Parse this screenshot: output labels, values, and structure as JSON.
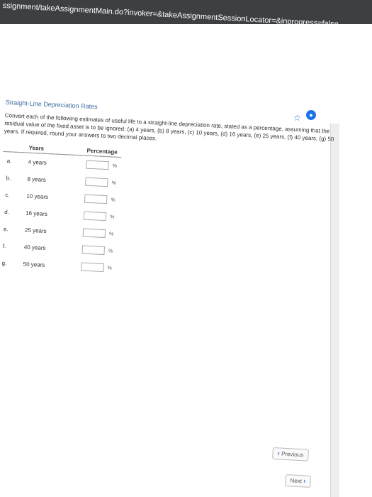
{
  "browser": {
    "url": "ssignment/takeAssignmentMain.do?invoker=&takeAssignmentSessionLocator=&inprogress=false"
  },
  "icons": {
    "star": "star-icon",
    "extension": "extension-icon"
  },
  "question": {
    "title": "Straight-Line Depreciation Rates",
    "instructions": "Convert each of the following estimates of useful life to a straight-line depreciation rate, stated as a percentage, assuming that the residual value of the fixed asset is to be ignored: (a) 4 years, (b) 8 years, (c) 10 years, (d) 16 years, (e) 25 years, (f) 40 years, (g) 50 years. If required, round your answers to two decimal places.",
    "headers": {
      "years": "Years",
      "percentage": "Percentage"
    },
    "percent_symbol": "%",
    "rows": [
      {
        "letter": "a.",
        "years": "4 years",
        "value": ""
      },
      {
        "letter": "b.",
        "years": "8 years",
        "value": ""
      },
      {
        "letter": "c.",
        "years": "10 years",
        "value": ""
      },
      {
        "letter": "d.",
        "years": "16 years",
        "value": ""
      },
      {
        "letter": "e.",
        "years": "25 years",
        "value": ""
      },
      {
        "letter": "f.",
        "years": "40 years",
        "value": ""
      },
      {
        "letter": "g.",
        "years": "50 years",
        "value": ""
      }
    ]
  },
  "navigation": {
    "previous_label": "Previous",
    "next_label": "Next"
  }
}
